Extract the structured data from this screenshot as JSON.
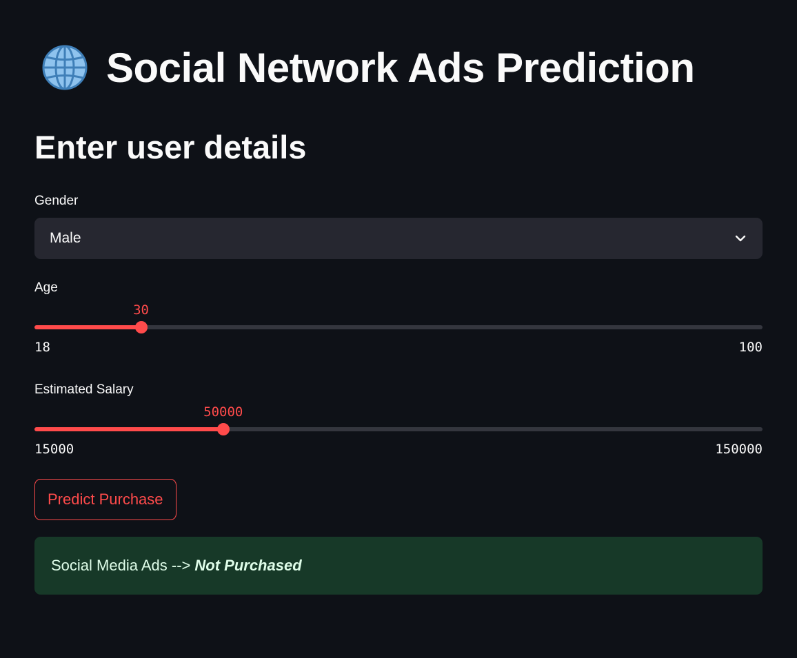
{
  "header": {
    "icon": "globe-icon",
    "title": "Social Network Ads Prediction"
  },
  "form": {
    "heading": "Enter user details",
    "gender": {
      "label": "Gender",
      "value": "Male"
    },
    "age": {
      "label": "Age",
      "value": "30",
      "min": "18",
      "max": "100"
    },
    "salary": {
      "label": "Estimated Salary",
      "value": "50000",
      "min": "15000",
      "max": "150000"
    },
    "predict_button_label": "Predict Purchase"
  },
  "result": {
    "prefix": "Social Media Ads -->",
    "value": "Not Purchased"
  },
  "colors": {
    "background": "#0e1117",
    "accent": "#ff4b4b",
    "success_bg": "#173928",
    "success_text": "#dffde9"
  }
}
